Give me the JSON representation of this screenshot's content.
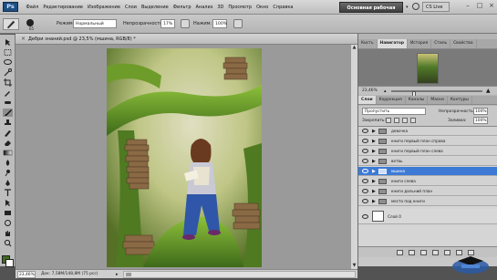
{
  "app": {
    "logo": "Ps",
    "menu": [
      "Файл",
      "Редактирование",
      "Изображение",
      "Слои",
      "Выделение",
      "Фильтр",
      "Анализ",
      "3D",
      "Просмотр",
      "Окно",
      "Справка"
    ],
    "zoom_value": "23,5",
    "workspace_label": "Основная рабочая среда",
    "cs_live_label": "CS Live",
    "window_controls": [
      "–",
      "□",
      "×"
    ]
  },
  "options_bar": {
    "brush_size": "65",
    "mode_label": "Режим:",
    "mode_value": "Нормальный",
    "opacity_label": "Непрозрачность:",
    "opacity_value": "17%",
    "pressure_label": "Нажим:",
    "pressure_value": "100%"
  },
  "document": {
    "tab_label": "Дебри знаний.psd @ 23,5% (мшина, RGB/8) *",
    "zoom_status": "23,46%",
    "doc_info": "Док: 7,58M/148,8M (75 pcc)"
  },
  "navigator": {
    "tabs": [
      "Кисть",
      "Навигатор",
      "История",
      "Стиль",
      "Свойства"
    ],
    "active_tab": 1,
    "zoom_value": "23,46%",
    "zoom_fraction": 0.24
  },
  "layers": {
    "tabs": [
      "Слои",
      "Коррекция",
      "Каналы",
      "Маски",
      "Контуры"
    ],
    "active_tab": 0,
    "blend_mode": "Пропустить",
    "opacity_label": "Непрозрачность:",
    "opacity_value": "100%",
    "lock_label": "Закрепить:",
    "fill_label": "Заливка:",
    "fill_value": "100%",
    "rows": [
      {
        "name": "девочка",
        "selected": false
      },
      {
        "name": "книги первый план справа",
        "selected": false
      },
      {
        "name": "книги первый план слева",
        "selected": false
      },
      {
        "name": "ветвь",
        "selected": false
      },
      {
        "name": "мшина",
        "selected": true
      },
      {
        "name": "книги слева",
        "selected": false
      },
      {
        "name": "книги дальний план",
        "selected": false
      },
      {
        "name": "место под книги",
        "selected": false
      }
    ],
    "background_layer": "Слой 0"
  },
  "colors": {
    "foreground": "#3f6a1e",
    "background": "#ffffff",
    "selection": "#3d7ad6",
    "nav_proxy": "#e0211b"
  }
}
